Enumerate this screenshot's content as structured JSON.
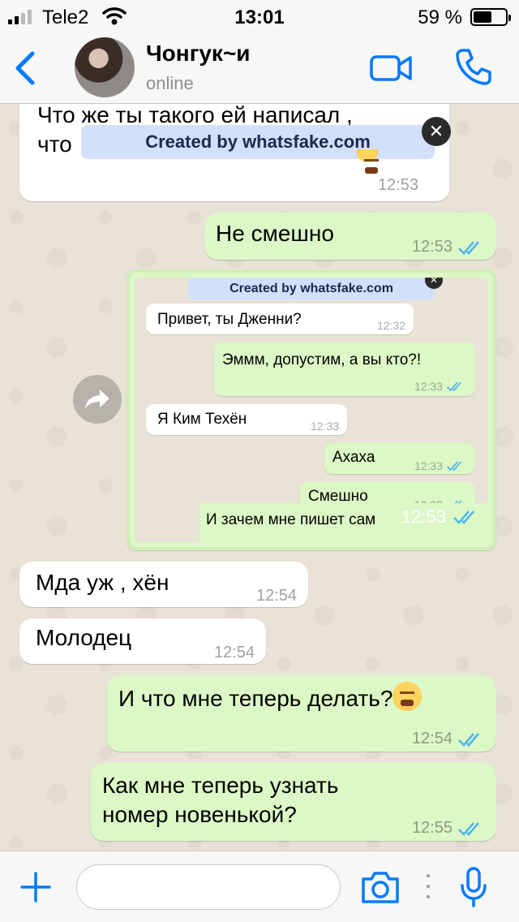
{
  "status_bar": {
    "carrier": "Tele2",
    "time": "13:01",
    "battery_percent": "59 %",
    "battery_level": 0.59
  },
  "header": {
    "contact_name": "Чонгук~и",
    "contact_status": "online"
  },
  "watermark": {
    "text": "Created by whatsfake.com"
  },
  "messages": [
    {
      "direction": "in",
      "text": "Что же ты такого ей написал ,\nчто",
      "time": "12:53"
    },
    {
      "direction": "out",
      "text": "Не смешно",
      "time": "12:53"
    },
    {
      "direction": "in",
      "text": "Мда уж , хён",
      "time": "12:54"
    },
    {
      "direction": "in",
      "text": "Молодец",
      "time": "12:54"
    },
    {
      "direction": "out",
      "text": "И что мне теперь делать?",
      "time": "12:54"
    },
    {
      "direction": "out",
      "text": "Как мне теперь узнать\nномер новенькой?",
      "time": "12:55"
    }
  ],
  "forwarded_screenshot": {
    "watermark": "Created by whatsfake.com",
    "messages": [
      {
        "direction": "in",
        "text": "Привет, ты Дженни?",
        "time": "12:32"
      },
      {
        "direction": "out",
        "text": "Эммм, допустим, а вы кто?!",
        "time": "12:33"
      },
      {
        "direction": "in",
        "text": "Я Ким Техён",
        "time": "12:33"
      },
      {
        "direction": "out",
        "text": "Ахаха",
        "time": "12:33"
      },
      {
        "direction": "out",
        "text": "Смешно",
        "time": "12:33"
      }
    ],
    "caption_text": "И зачем мне пишет сам",
    "caption_time": "12:53"
  },
  "colors": {
    "accent": "#007aff",
    "outgoing_bubble": "#dcf8c6",
    "incoming_bubble": "#ffffff",
    "read_ticks": "#4fb6ec",
    "chat_background": "#e9e2d7"
  },
  "input_bar": {
    "placeholder": ""
  }
}
